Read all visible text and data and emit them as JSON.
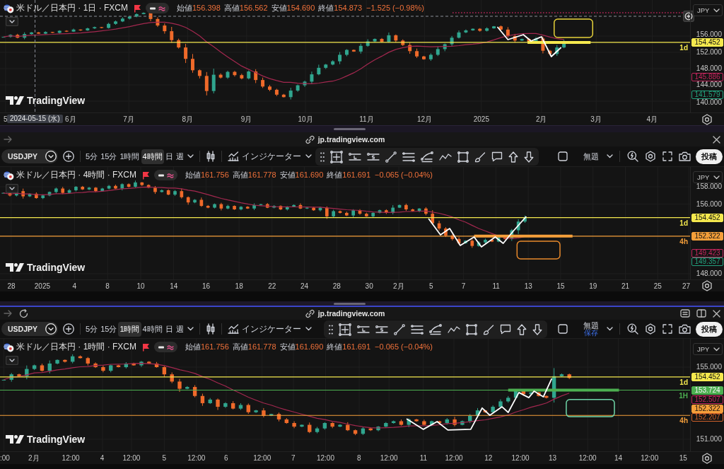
{
  "windows": [
    {
      "chart": {
        "legend": {
          "title": "米ドル／日本円 · 1日 · FXCM",
          "ohlc": [
            {
              "label": "始値",
              "value": "156.398"
            },
            {
              "label": "高値",
              "value": "156.562"
            },
            {
              "label": "安値",
              "value": "154.690"
            },
            {
              "label": "終値",
              "value": "154.873"
            }
          ],
          "change": "−1.525 (−0.98%)"
        },
        "currency": "JPY",
        "logo": "TradingView",
        "price_tags": [
          {
            "text": "154.452",
            "kind": "filled",
            "color": "#f5e94e",
            "line_label": "1d"
          },
          {
            "text": "145.886",
            "kind": "outlined",
            "color": "#c2255c"
          },
          {
            "text": "141.579",
            "kind": "outlined",
            "color": "#22a07c"
          }
        ],
        "price_axis": [
          "156.000",
          "152.000",
          "148.000",
          "144.000",
          "140.000"
        ],
        "time_axis": [
          "5",
          "6月",
          "7月",
          "8月",
          "9月",
          "10月",
          "11月",
          "12月",
          "2025",
          "2月",
          "3月",
          "4月"
        ],
        "crosshair_date": "2024-05-15 (水)"
      }
    },
    {
      "address_bar": {
        "kind": "popup",
        "url": "jp.tradingview.com"
      },
      "toolbar": {
        "symbol": "USDJPY",
        "intervals": [
          {
            "label": "5分",
            "selected": false
          },
          {
            "label": "15分",
            "selected": false
          },
          {
            "label": "1時間",
            "selected": false
          },
          {
            "label": "4時間",
            "selected": true
          },
          {
            "label": "日",
            "selected": false
          },
          {
            "label": "週",
            "selected": false
          }
        ],
        "indicators_label": "インジケーター",
        "layout_name": "無題",
        "publish_label": "投稿"
      },
      "chart": {
        "legend": {
          "title": "米ドル／日本円 · 4時間 · FXCM",
          "ohlc": [
            {
              "label": "始値",
              "value": "161.756"
            },
            {
              "label": "高値",
              "value": "161.778"
            },
            {
              "label": "安値",
              "value": "161.690"
            },
            {
              "label": "終値",
              "value": "161.691"
            }
          ],
          "change": "−0.065 (−0.04%)"
        },
        "currency": "JPY",
        "logo": "TradingView",
        "price_tags": [
          {
            "text": "154.452",
            "kind": "filled",
            "color": "#f5e94e",
            "line_label": "1d"
          },
          {
            "text": "152.322",
            "kind": "filled",
            "color": "#f59f3a",
            "line_label": "4h"
          },
          {
            "text": "149.423",
            "kind": "outlined",
            "color": "#c2255c"
          },
          {
            "text": "149.357",
            "kind": "outlined",
            "color": "#22a07c"
          }
        ],
        "price_axis": [
          "158.000",
          "156.000",
          "148.000"
        ],
        "time_axis": [
          "28",
          "2025",
          "4",
          "8",
          "10",
          "14",
          "16",
          "18",
          "22",
          "24",
          "28",
          "30",
          "2月",
          "5",
          "7",
          "11",
          "13",
          "15",
          "19",
          "21",
          "25",
          "27"
        ]
      }
    },
    {
      "address_bar": {
        "kind": "tab",
        "url": "jp.tradingview.com"
      },
      "toolbar": {
        "symbol": "USDJPY",
        "intervals": [
          {
            "label": "5分",
            "selected": false
          },
          {
            "label": "15分",
            "selected": false
          },
          {
            "label": "1時間",
            "selected": true
          },
          {
            "label": "4時間",
            "selected": false
          },
          {
            "label": "日",
            "selected": false
          },
          {
            "label": "週",
            "selected": false
          }
        ],
        "indicators_label": "インジケーター",
        "layout_name": "無題",
        "layout_status": "保存",
        "publish_label": "投稿"
      },
      "chart": {
        "legend": {
          "title": "米ドル／日本円 · 1時間 · FXCM",
          "ohlc": [
            {
              "label": "始値",
              "value": "161.756"
            },
            {
              "label": "高値",
              "value": "161.778"
            },
            {
              "label": "安値",
              "value": "161.690"
            },
            {
              "label": "終値",
              "value": "161.691"
            }
          ],
          "change": "−0.065 (−0.04%)"
        },
        "currency": "JPY",
        "logo": "TradingView",
        "price_tags": [
          {
            "text": "154.452",
            "kind": "filled",
            "color": "#f5e94e",
            "line_label": "1d"
          },
          {
            "text": "153.724",
            "kind": "filled",
            "color": "#4caf50",
            "line_label": "1H"
          },
          {
            "text": "152.507",
            "kind": "outlined",
            "color": "#c2255c"
          },
          {
            "text": "152.322",
            "kind": "filled",
            "color": "#f59f3a",
            "line_label": "4h"
          },
          {
            "text": "152.207",
            "kind": "outlined",
            "color": "#d2622a"
          }
        ],
        "price_axis": [
          "155.000",
          "151.000"
        ],
        "time_axis": [
          ":00",
          "2月",
          "12:00",
          "4",
          "12:00",
          "5",
          "12:00",
          "6",
          "12:00",
          "7",
          "12:00",
          "8",
          "12:00",
          "11",
          "12:00",
          "12",
          "12:00",
          "13",
          "12:00",
          "14",
          "12:00",
          "15"
        ]
      }
    }
  ]
}
